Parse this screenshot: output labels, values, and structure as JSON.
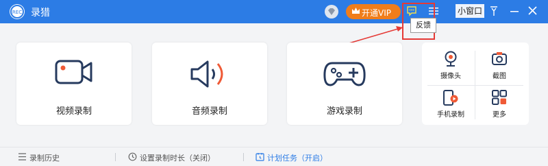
{
  "window": {
    "title": "录猎"
  },
  "titlebar": {
    "vip_label": "开通VIP",
    "mini_window_label": "小窗口"
  },
  "tooltip": {
    "text": "反馈"
  },
  "cards": [
    {
      "id": "video",
      "label": "视频录制"
    },
    {
      "id": "audio",
      "label": "音频录制"
    },
    {
      "id": "game",
      "label": "游戏录制"
    }
  ],
  "small_tools": [
    {
      "id": "camera",
      "label": "摄像头"
    },
    {
      "id": "screenshot",
      "label": "截图"
    },
    {
      "id": "phone",
      "label": "手机录制"
    },
    {
      "id": "more",
      "label": "更多"
    }
  ],
  "statusbar": {
    "history": "录制历史",
    "duration": "设置录制时长（关闭）",
    "schedule": "计划任务（开启）"
  },
  "colors": {
    "titlebar": "#2c7ce5",
    "vip": "#f07d1a",
    "accent_red": "#e53935",
    "blue": "#2c7ce5"
  }
}
